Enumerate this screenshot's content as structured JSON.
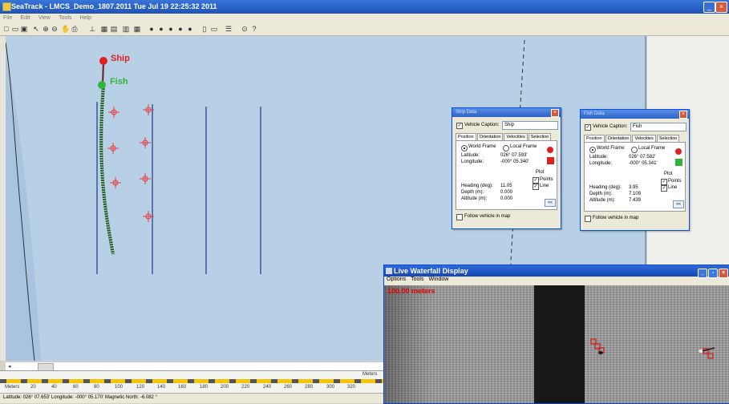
{
  "window": {
    "title": "SeaTrack - LMCS_Demo_1807.2011  Tue Jul 19 22:25:32 2011"
  },
  "menu": [
    "File",
    "Edit",
    "View",
    "Tools",
    "Help"
  ],
  "map": {
    "ship_label": "Ship",
    "fish_label": "Fish",
    "colors": {
      "water": "#b8d0e6",
      "ship": "#e02020",
      "fish": "#32b43a",
      "track": "#1d4f14",
      "survey_line": "#2b3f8c",
      "target": "#e83a3a"
    }
  },
  "scale": {
    "unit_left": "Meters",
    "unit_right": "Meters",
    "ticks": [
      "20",
      "40",
      "60",
      "80",
      "100",
      "120",
      "140",
      "160",
      "180",
      "200",
      "220",
      "240",
      "260",
      "280",
      "300",
      "320"
    ]
  },
  "status": {
    "text": "Latitude: 026° 07.653' Longitude: -000° 05.170' Magnetic North: -6.082 °"
  },
  "ship_dialog": {
    "title": "Ship Data",
    "vehicle_caption_label": "Vehicle Caption:",
    "vehicle_caption_value": "Ship",
    "tabs": [
      "Position",
      "Orientation",
      "Velocities",
      "Selection"
    ],
    "frame_world": "World Frame",
    "frame_local": "Local Frame",
    "lat_label": "Latitude:",
    "lat_value": "026° 07.593'",
    "lon_label": "Longitude:",
    "lon_value": "-000° 05.340'",
    "plot_label": "Plot",
    "points_label": "Points",
    "line_label": "Line",
    "heading_label": "Heading (deg):",
    "heading_value": "11.05",
    "depth_label": "Depth (m):",
    "depth_value": "0.000",
    "altitude_label": "Altitude (m):",
    "altitude_value": "0.000",
    "more_button": "<<",
    "follow_label": "Follow vehicle in map"
  },
  "fish_dialog": {
    "title": "Fish Data",
    "vehicle_caption_label": "Vehicle Caption:",
    "vehicle_caption_value": "Fish",
    "tabs": [
      "Position",
      "Orientation",
      "Velocities",
      "Selection"
    ],
    "frame_world": "World Frame",
    "frame_local": "Local Frame",
    "lat_label": "Latitude:",
    "lat_value": "026° 07.582'",
    "lon_label": "Longitude:",
    "lon_value": "-000° 05.341'",
    "plot_label": "Plot",
    "points_label": "Points",
    "line_label": "Line",
    "heading_label": "Heading (deg):",
    "heading_value": "3.95",
    "depth_label": "Depth (m):",
    "depth_value": "7.109",
    "altitude_label": "Altitude (m):",
    "altitude_value": "7.439",
    "more_button": "<<",
    "follow_label": "Follow vehicle in map"
  },
  "waterfall": {
    "title": "Live Waterfall Display",
    "menu": [
      "Options",
      "Tools",
      "Window"
    ],
    "range_label": "100.00 meters"
  }
}
